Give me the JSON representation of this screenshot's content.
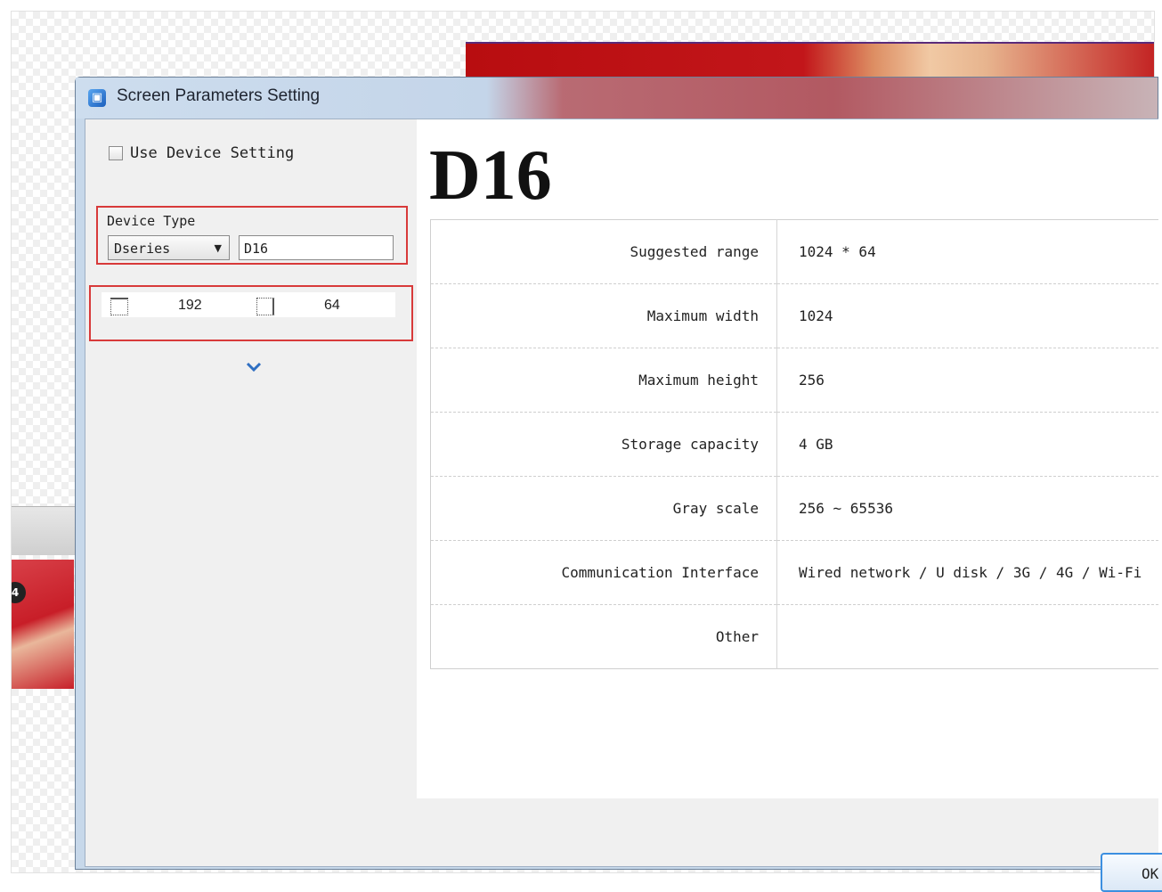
{
  "dialog": {
    "title": "Screen Parameters Setting"
  },
  "left_panel": {
    "use_device_setting_label": "Use Device Setting",
    "device_type_label": "Device Type",
    "series_selected": "Dseries",
    "model_input_value": "D16",
    "width_value": "192",
    "height_value": "64"
  },
  "right_panel": {
    "model_title": "D16",
    "specs": [
      {
        "label": "Suggested range",
        "value": "1024 * 64"
      },
      {
        "label": "Maximum width",
        "value": "1024"
      },
      {
        "label": "Maximum height",
        "value": "256"
      },
      {
        "label": "Storage capacity",
        "value": "4 GB"
      },
      {
        "label": "Gray scale",
        "value": "256 ~ 65536"
      },
      {
        "label": "Communication Interface",
        "value": "Wired network / U disk / 3G / 4G / Wi-Fi"
      },
      {
        "label": "Other",
        "value": ""
      }
    ]
  },
  "footer": {
    "ok_label": "OK"
  },
  "background": {
    "thumbnail_badge": "4"
  },
  "icons": {
    "app": "screen-settings-icon",
    "width": "width-dimension-icon",
    "height": "height-dimension-icon",
    "dropdown": "dropdown-arrow-icon",
    "expand": "chevron-down-icon"
  },
  "colors": {
    "highlight_border": "#d83a3a",
    "accent_blue": "#2f6fc2"
  }
}
